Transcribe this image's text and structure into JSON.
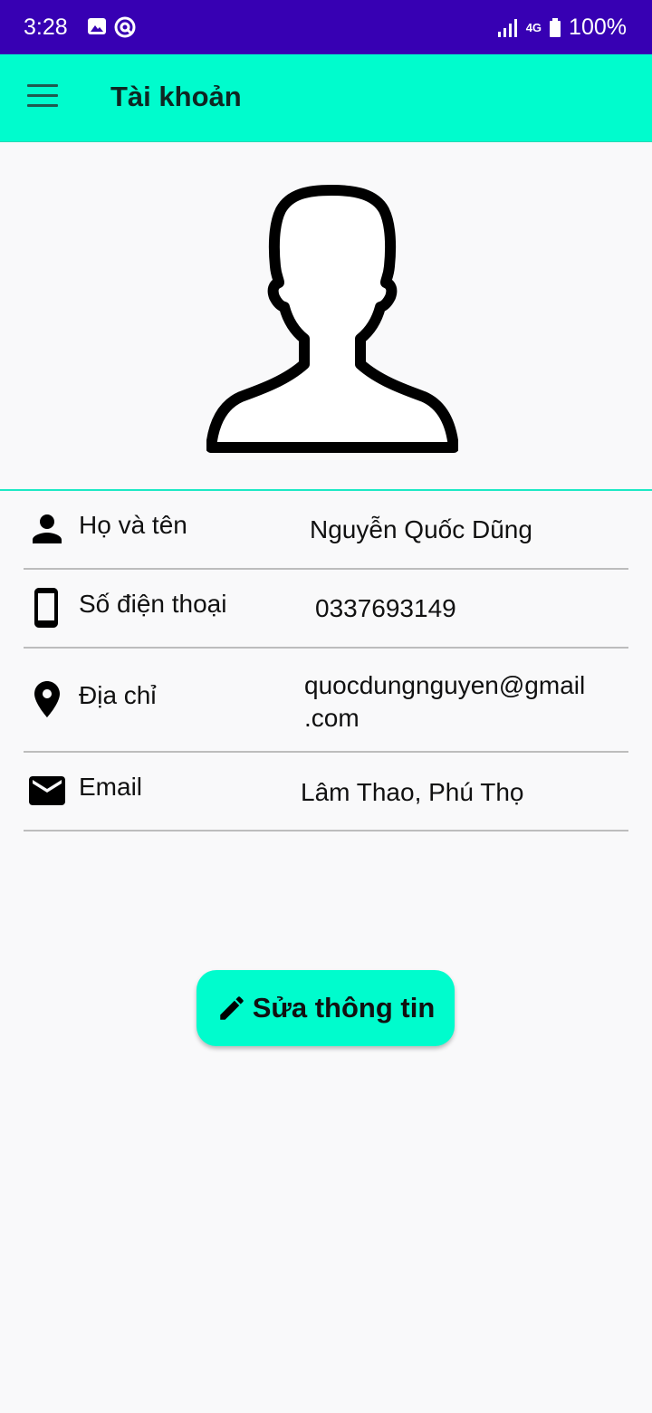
{
  "status_bar": {
    "time": "3:28",
    "network": "4G",
    "battery": "100%"
  },
  "app_bar": {
    "title": "Tài khoản"
  },
  "profile": {
    "rows": [
      {
        "icon": "person-icon",
        "label": "Họ và tên",
        "value": "Nguyễn Quốc Dũng"
      },
      {
        "icon": "phone-icon",
        "label": "Số điện thoại",
        "value": "0337693149"
      },
      {
        "icon": "location-pin-icon",
        "label": "Địa chỉ",
        "value_line1": "quocdungnguyen@gmail",
        "value_line2": ".com"
      },
      {
        "icon": "mail-icon",
        "label": "Email",
        "value": "Lâm Thao, Phú Thọ"
      }
    ]
  },
  "edit_button": {
    "label": "Sửa thông tin",
    "icon": "pencil-icon"
  },
  "colors": {
    "status_bar": "#3700b3",
    "accent": "#00fccd",
    "background": "#f9f9fa"
  }
}
